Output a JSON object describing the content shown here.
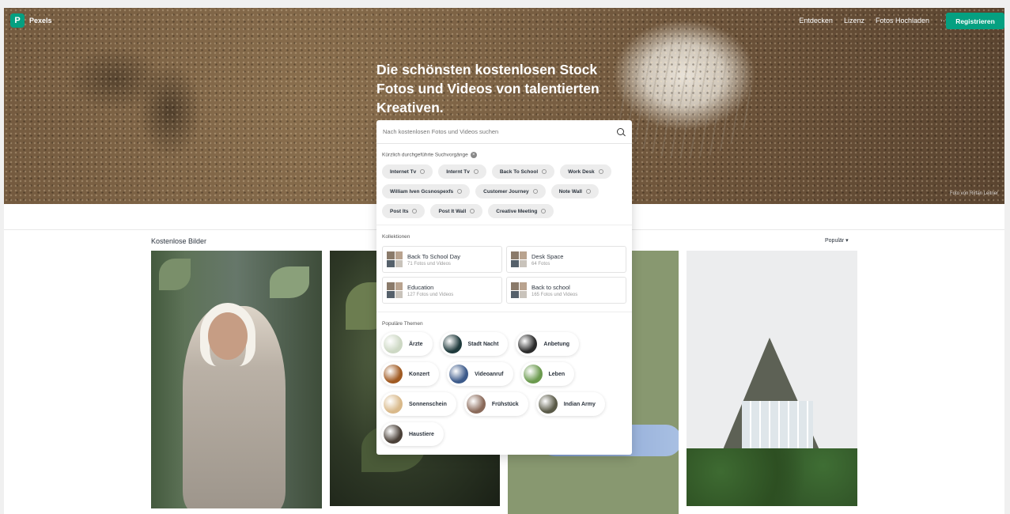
{
  "brand": {
    "name": "Pexels",
    "logo_letter": "P",
    "color": "#05a081"
  },
  "nav": {
    "links": [
      "Entdecken",
      "Lizenz",
      "Fotos Hochladen",
      "···"
    ],
    "register": "Registrieren"
  },
  "hero": {
    "title": "Die schönsten kostenlosen Stock Fotos und Videos von talentierten Kreativen.",
    "credit": "Foto von Rirfan Leitner"
  },
  "search": {
    "placeholder": "Nach kostenlosen Fotos und Videos suchen",
    "recent_label": "Kürzlich durchgeführte Suchvorgänge",
    "recent": [
      "Internet Tv",
      "Internt Tv",
      "Back To School",
      "Work Desk",
      "William Iven Gcsnospexfs",
      "Customer Journey",
      "Note Wall",
      "Post Its",
      "Post It Wall",
      "Creative Meeting"
    ],
    "collections_label": "Kollektionen",
    "collections": [
      {
        "name": "Back To School Day",
        "count": "71 Fotos und Videos"
      },
      {
        "name": "Desk Space",
        "count": "64 Fotos"
      },
      {
        "name": "Education",
        "count": "127 Fotos und Videos"
      },
      {
        "name": "Back to school",
        "count": "165 Fotos und Videos"
      }
    ],
    "topics_label": "Populäre Themen",
    "topics": [
      {
        "name": "Ärzte",
        "color": "#cdd8c4"
      },
      {
        "name": "Stadt Nacht",
        "color": "#1f3a3c"
      },
      {
        "name": "Anbetung",
        "color": "#2b2b2b"
      },
      {
        "name": "Konzert",
        "color": "#a05a22"
      },
      {
        "name": "Videoanruf",
        "color": "#3c5a8a"
      },
      {
        "name": "Leben",
        "color": "#6b9a4e"
      },
      {
        "name": "Sonnenschein",
        "color": "#d9b98a"
      },
      {
        "name": "Frühstück",
        "color": "#8a6a5a"
      },
      {
        "name": "Indian Army",
        "color": "#5a5a48"
      },
      {
        "name": "Haustiere",
        "color": "#4a4038"
      }
    ]
  },
  "gallery": {
    "title": "Kostenlose Bilder",
    "sort": "Populär ▾"
  }
}
